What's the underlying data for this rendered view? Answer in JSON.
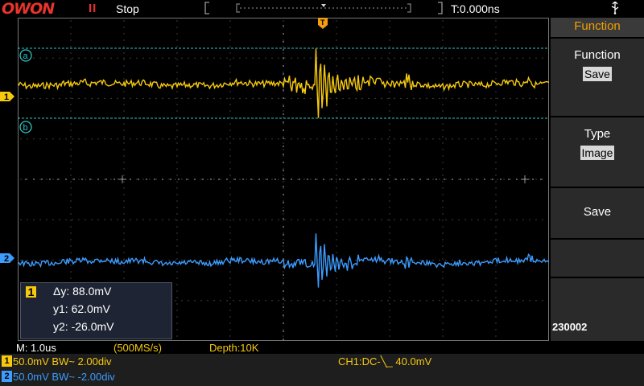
{
  "topbar": {
    "logo": "OWON",
    "run_icon": "II",
    "run_state": "Stop",
    "trigger_time": "T:0.000ns",
    "usb_icon": "usb-icon"
  },
  "markers": {
    "trigger_marker": "T",
    "cursor_a": "a",
    "cursor_b": "b",
    "ch1_marker": "1",
    "ch2_marker": "2"
  },
  "menu": {
    "header": "Function",
    "items": [
      {
        "title": "Function",
        "value": "Save"
      },
      {
        "title": "Type",
        "value": "Image"
      },
      {
        "title": "Save",
        "value": ""
      }
    ],
    "serial": "230002"
  },
  "cursor": {
    "badge": "1",
    "dy": "Δy: 88.0mV",
    "y1": "y1: 62.0mV",
    "y2": "y2: -26.0mV"
  },
  "status": {
    "timebase": "M: 1.0us",
    "sample_rate": "(500MS/s)",
    "depth": "Depth:10K",
    "ch1_badge": "1",
    "ch1": "50.0mV BW~ 2.00div",
    "ch2_badge": "2",
    "ch2": "50.0mV BW~ -2.00div",
    "trigger": "CH1:DC-╲_ 40.0mV"
  },
  "colors": {
    "ch1": "#f6c90e",
    "ch2": "#3c9cff",
    "cursor_line": "#2ec4c4",
    "logo": "#e8342c",
    "trigger_marker": "#f39c12"
  }
}
